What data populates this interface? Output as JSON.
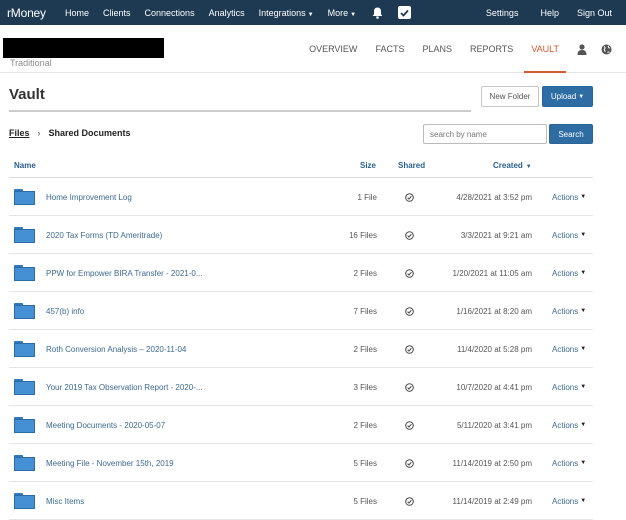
{
  "nav": {
    "brand": "rMoney",
    "items": [
      "Home",
      "Clients",
      "Connections",
      "Analytics",
      "Integrations",
      "More"
    ],
    "right_items": [
      "Settings",
      "Help",
      "Sign Out"
    ]
  },
  "client": {
    "type_label": "Traditional",
    "tabs": [
      "OVERVIEW",
      "FACTS",
      "PLANS",
      "REPORTS",
      "VAULT"
    ],
    "active_tab": "VAULT"
  },
  "vault": {
    "title": "Vault",
    "new_folder_label": "New Folder",
    "upload_label": "Upload"
  },
  "breadcrumb": {
    "root": "Files",
    "current": "Shared Documents"
  },
  "search": {
    "placeholder": "search by name",
    "button_label": "Search"
  },
  "table": {
    "headers": {
      "name": "Name",
      "size": "Size",
      "shared": "Shared",
      "created": "Created"
    },
    "rows": [
      {
        "name": "Home Improvement Log",
        "size": "1 File",
        "created": "4/28/2021 at 3:52 pm",
        "actions": "Actions"
      },
      {
        "name": "2020 Tax Forms (TD Ameritrade)",
        "size": "16 Files",
        "created": "3/3/2021 at 9:21 am",
        "actions": "Actions"
      },
      {
        "name": "PPW for Empower BIRA Transfer - 2021-0...",
        "size": "2 Files",
        "created": "1/20/2021 at 11:05 am",
        "actions": "Actions"
      },
      {
        "name": "457(b) info",
        "size": "7 Files",
        "created": "1/16/2021 at 8:20 am",
        "actions": "Actions"
      },
      {
        "name": "Roth Conversion Analysis – 2020-11-04",
        "size": "2 Files",
        "created": "11/4/2020 at 5:28 pm",
        "actions": "Actions"
      },
      {
        "name": "Your 2019 Tax Observation Report - 2020-...",
        "size": "3 Files",
        "created": "10/7/2020 at 4:41 pm",
        "actions": "Actions"
      },
      {
        "name": "Meeting Documents - 2020-05-07",
        "size": "2 Files",
        "created": "5/11/2020 at 3:41 pm",
        "actions": "Actions"
      },
      {
        "name": "Meeting File - November 15th, 2019",
        "size": "5 Files",
        "created": "11/14/2019 at 2:50 pm",
        "actions": "Actions"
      },
      {
        "name": "Misc Items",
        "size": "5 Files",
        "created": "11/14/2019 at 2:49 pm",
        "actions": "Actions"
      }
    ]
  },
  "colors": {
    "nav_bg": "#1e3a52",
    "accent": "#d35b2f",
    "primary_button": "#2e6da4",
    "folder": "#4590d4",
    "link": "#3c6a91"
  }
}
